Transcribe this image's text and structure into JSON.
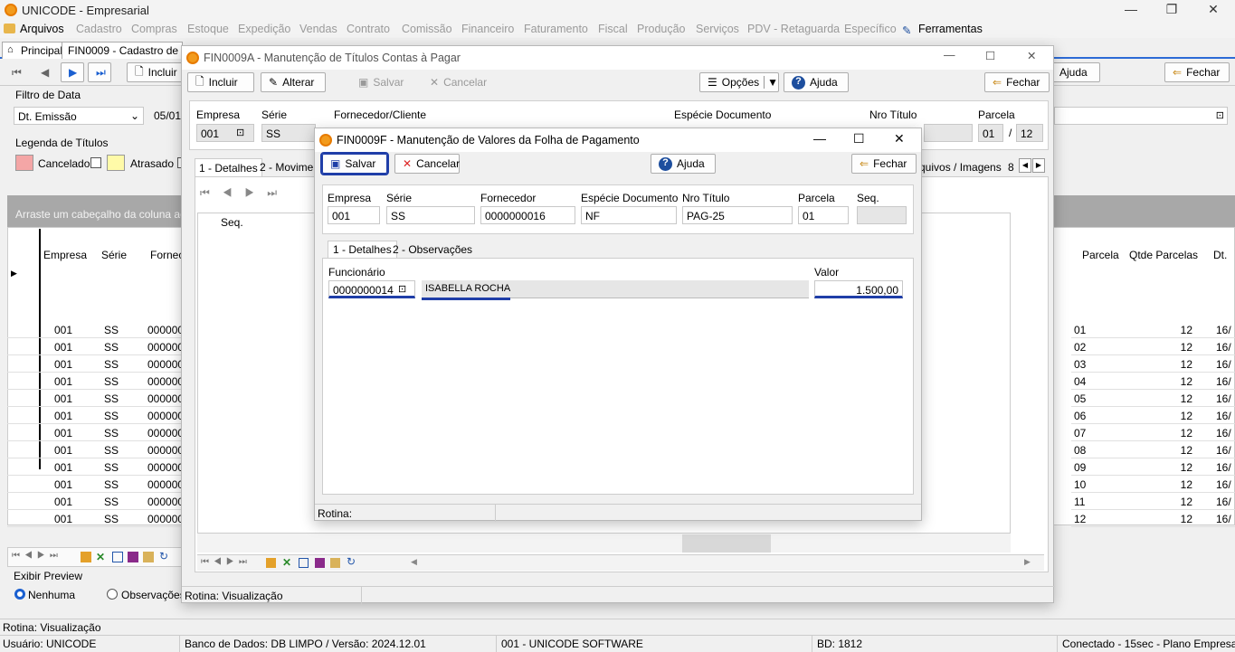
{
  "app": {
    "title": "UNICODE - Empresarial",
    "min": "—",
    "max": "❐",
    "close": "✕"
  },
  "menu": [
    "Arquivos",
    "Cadastro",
    "Compras",
    "Estoque",
    "Expedição",
    "Vendas",
    "Contrato",
    "Comissão",
    "Financeiro",
    "Faturamento",
    "Fiscal",
    "Produção",
    "Serviços",
    "PDV - Retaguarda",
    "Específico",
    "Ferramentas"
  ],
  "tabs": {
    "principal": "Principal",
    "fin0009": "FIN0009 - Cadastro de Co"
  },
  "bg": {
    "incluir": "Incluir",
    "ajuda": "Ajuda",
    "fechar": "Fechar",
    "filtro_label": "Filtro de Data",
    "filtro_value": "Dt. Emissão",
    "date_value": "05/01/",
    "legenda_label": "Legenda de Títulos",
    "cancelado": "Cancelado",
    "atrasado": "Atrasado",
    "group_hint": "Arraste um cabeçalho da coluna aqui p",
    "cols": [
      "Empresa",
      "Série",
      "Fornec"
    ],
    "rows": [
      [
        "001",
        "SS",
        "000000"
      ],
      [
        "001",
        "SS",
        "000000"
      ],
      [
        "001",
        "SS",
        "000000"
      ],
      [
        "001",
        "SS",
        "000000"
      ],
      [
        "001",
        "SS",
        "000000"
      ],
      [
        "001",
        "SS",
        "000000"
      ],
      [
        "001",
        "SS",
        "000000"
      ],
      [
        "001",
        "SS",
        "000000"
      ],
      [
        "001",
        "SS",
        "000000"
      ],
      [
        "001",
        "SS",
        "000000"
      ],
      [
        "001",
        "SS",
        "000000"
      ],
      [
        "001",
        "SS",
        "000000"
      ]
    ],
    "right_cols": [
      "Parcela",
      "Qtde Parcelas",
      "Dt."
    ],
    "right_rows": [
      [
        "01",
        "12",
        "16/"
      ],
      [
        "02",
        "12",
        "16/"
      ],
      [
        "03",
        "12",
        "16/"
      ],
      [
        "04",
        "12",
        "16/"
      ],
      [
        "05",
        "12",
        "16/"
      ],
      [
        "06",
        "12",
        "16/"
      ],
      [
        "07",
        "12",
        "16/"
      ],
      [
        "08",
        "12",
        "16/"
      ],
      [
        "09",
        "12",
        "16/"
      ],
      [
        "10",
        "12",
        "16/"
      ],
      [
        "11",
        "12",
        "16/"
      ],
      [
        "12",
        "12",
        "16/"
      ]
    ],
    "exibir": "Exibir Preview",
    "nenhuma": "Nenhuma",
    "observacoes": "Observações",
    "rotina": "Rotina: Visualização"
  },
  "win_a": {
    "title": "FIN0009A - Manutenção de Títulos Contas à Pagar",
    "incluir": "Incluir",
    "alterar": "Alterar",
    "salvar": "Salvar",
    "cancelar": "Cancelar",
    "opcoes": "Opções",
    "ajuda": "Ajuda",
    "fechar": "Fechar",
    "labels": {
      "empresa": "Empresa",
      "serie": "Série",
      "fornecedor": "Fornecedor/Cliente",
      "especie": "Espécie Documento",
      "nro": "Nro Título",
      "parcela": "Parcela"
    },
    "empresa": "001",
    "serie": "SS",
    "parcela": "01",
    "parcela_total": "12",
    "parcela_sep": "/",
    "tab1": "1 - Detalhes",
    "tab2": "2 - Moviment",
    "tab_arq": "quivos / Imagens",
    "tab_num": "8",
    "seq": "Seq.",
    "rotina": "Rotina: Visualização"
  },
  "win_f": {
    "title": "FIN0009F - Manutenção de Valores da Folha de Pagamento",
    "salvar": "Salvar",
    "cancelar": "Cancelar",
    "ajuda": "Ajuda",
    "fechar": "Fechar",
    "labels": {
      "empresa": "Empresa",
      "serie": "Série",
      "fornecedor": "Fornecedor",
      "especie": "Espécie Documento",
      "nro": "Nro Título",
      "parcela": "Parcela",
      "seq": "Seq."
    },
    "empresa": "001",
    "serie": "SS",
    "fornecedor": "0000000016",
    "especie": "NF",
    "nro": "PAG-25",
    "parcela": "01",
    "seq": "",
    "tab1": "1 - Detalhes",
    "tab2": "2 - Observações",
    "funcionario_label": "Funcionário",
    "funcionario_code": "0000000014",
    "funcionario_name": "ISABELLA ROCHA",
    "valor_label": "Valor",
    "valor": "1.500,00",
    "rotina": "Rotina:"
  },
  "status": {
    "rotina": "Rotina: Visualização",
    "usuario": "Usuário: UNICODE",
    "banco": "Banco de Dados: DB LIMPO / Versão: 2024.12.01",
    "empresa": "001 - UNICODE SOFTWARE",
    "bd": "BD: 1812",
    "conectado": "Conectado - 15sec  -  Plano Empresa"
  },
  "colors": {
    "accent": "#2d6bd6",
    "highlight": "#1f3ea8",
    "grid_header": "#a8a8a8",
    "cancelado": "#f4a6a6",
    "atrasado": "#fffaa8"
  }
}
